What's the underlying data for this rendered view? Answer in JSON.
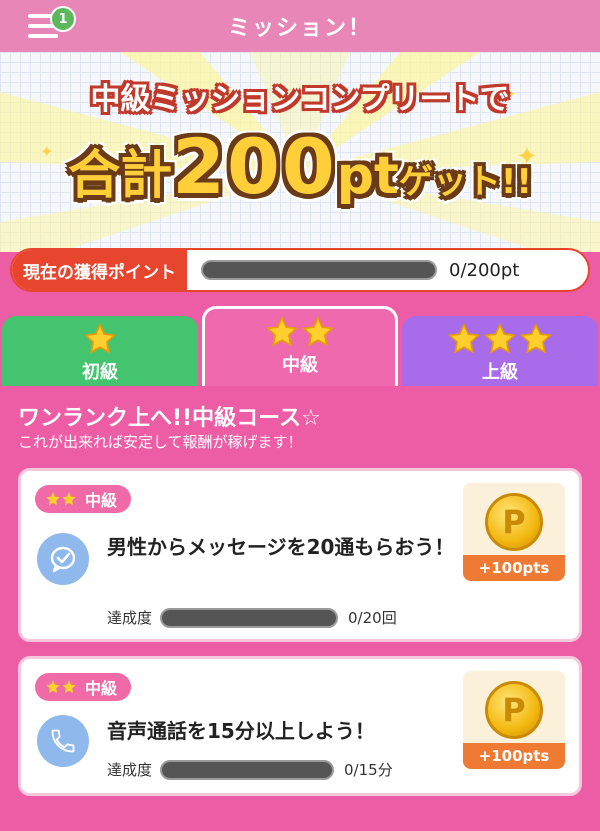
{
  "header": {
    "title": "ミッション！",
    "menu_badge": "1"
  },
  "banner": {
    "line1": "中級ミッションコンプリートで",
    "line2_prefix": "合計",
    "line2_amount": "200",
    "line2_unit": "pt",
    "line2_suffix": "ゲット!!"
  },
  "points": {
    "label": "現在の獲得ポイント",
    "value": "0/200pt",
    "progress": 0
  },
  "tabs": [
    {
      "label": "初級",
      "stars": 1,
      "color": "#44c46f"
    },
    {
      "label": "中級",
      "stars": 2,
      "color": "#ef69ae",
      "selected": true
    },
    {
      "label": "上級",
      "stars": 3,
      "color": "#a86bea"
    }
  ],
  "section": {
    "title": "ワンランク上へ!!中級コース☆",
    "subtitle": "これが出来れば安定して報酬が稼げます！"
  },
  "missions": [
    {
      "level": "中級",
      "icon": "chat-bubble-icon",
      "text": "男性からメッセージを20通もらおう！",
      "progress_label": "達成度",
      "progress_value": "0/20回",
      "progress": 0,
      "reward": "+100pts"
    },
    {
      "level": "中級",
      "icon": "phone-icon",
      "text": "音声通話を15分以上しよう！",
      "progress_label": "達成度",
      "progress_value": "0/15分",
      "progress": 0,
      "reward": "+100pts"
    }
  ],
  "colors": {
    "accent_pink": "#ec5da6",
    "points_red": "#e8452f",
    "reward_orange": "#ee7a34",
    "coin_gold": "#f3b710"
  }
}
